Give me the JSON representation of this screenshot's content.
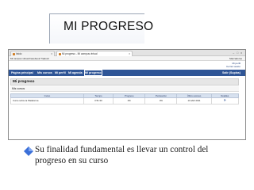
{
  "slide": {
    "title": "MI PROGRESO",
    "bullet_line1": "Su finalidad fundamental es llevar un control del",
    "bullet_line2": "progreso en su curso"
  },
  "browser": {
    "tabs": [
      {
        "label": "Inicio",
        "close": "x"
      },
      {
        "label": "Mi progreso - Mi campus virtual",
        "close": "x"
      }
    ],
    "window_buttons": "– □ x",
    "navbar_left": "Mi campus virtual   Facebook   Traducir",
    "navbar_right": "Marcadores"
  },
  "banner": {
    "link1": "Mi perfil",
    "link2": "Cerrar sesión"
  },
  "menu": {
    "items": [
      "Página principal",
      "Mis cursos",
      "Mi perfil",
      "Mi agenda",
      "Mi progreso"
    ],
    "right_item": "Salir (Suplas)"
  },
  "page": {
    "heading": "Mi progreso",
    "section": "Mis cursos"
  },
  "progress_table": {
    "columns": [
      "Curso",
      "Tiempo",
      "Progreso",
      "Puntuación",
      "Último acceso",
      "Detalles"
    ],
    "rows": [
      {
        "course": "Curso sobre la Plataforma",
        "time": "0:51:30",
        "progress": "0%",
        "score": "0%",
        "last_access": "13 abril 2011",
        "details_icon": "arrow-right-double"
      }
    ]
  },
  "colors": {
    "menubar": "#2f5596",
    "table_header": "#d7e1ef",
    "bullet": "#3a6fd8"
  }
}
